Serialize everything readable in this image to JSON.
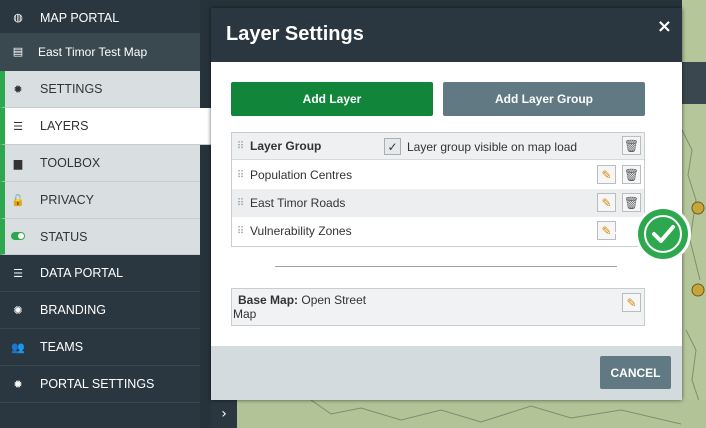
{
  "sidebar": {
    "items": [
      {
        "label": "MAP PORTAL",
        "icon": "globe-icon"
      },
      {
        "label": "East Timor Test Map",
        "icon": "map-panel-icon"
      },
      {
        "label": "SETTINGS",
        "icon": "gear-icon"
      },
      {
        "label": "LAYERS",
        "icon": "layers-icon"
      },
      {
        "label": "TOOLBOX",
        "icon": "toolbox-icon"
      },
      {
        "label": "PRIVACY",
        "icon": "lock-icon"
      },
      {
        "label": "STATUS",
        "icon": "toggle-icon"
      },
      {
        "label": "DATA PORTAL",
        "icon": "database-icon"
      },
      {
        "label": "BRANDING",
        "icon": "badge-icon"
      },
      {
        "label": "TEAMS",
        "icon": "users-icon"
      },
      {
        "label": "PORTAL SETTINGS",
        "icon": "gear-icon"
      }
    ],
    "active_item": "LAYERS"
  },
  "modal": {
    "title": "Layer Settings",
    "close_glyph": "×",
    "add_layer_label": "Add Layer",
    "add_layer_group_label": "Add Layer Group",
    "layer_group": {
      "title": "Layer Group",
      "visible_label": "Layer group visible on map load",
      "visible_checked": true,
      "check_glyph": "✓"
    },
    "layers": [
      {
        "name": "Population Centres",
        "deletable": true
      },
      {
        "name": "East Timor Roads",
        "deletable": true
      },
      {
        "name": "Vulnerability Zones",
        "deletable": false
      }
    ],
    "base_map": {
      "label": "Base Map:",
      "value": "Open Street Map"
    },
    "cancel_label": "CANCEL"
  },
  "colors": {
    "header_bg": "#2b3740",
    "add_layer_green": "#118539",
    "secondary_slate": "#607983",
    "success_green": "#2ea84f",
    "active_indicator": "#2ea84f"
  }
}
